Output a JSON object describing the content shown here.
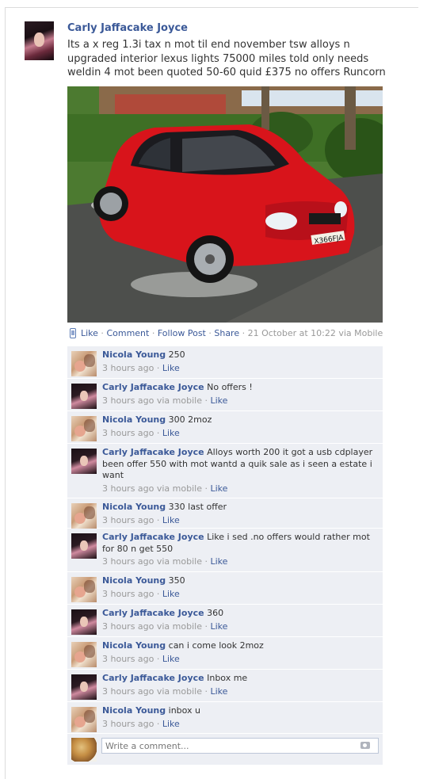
{
  "post": {
    "author": "Carly Jaffacake Joyce",
    "text": "Its a x reg 1.3i tax n mot til end november tsw alloys n upgraded interior lexus lights 75000 miles told only needs weldin 4 mot been quoted 50-60 quid £375 no offers Runcorn",
    "photo_plate": "X366FJA"
  },
  "actions": {
    "like": "Like",
    "comment": "Comment",
    "follow": "Follow Post",
    "share": "Share",
    "sep": " · ",
    "timestamp": "21 October at 10:22 via Mobile"
  },
  "comments": [
    {
      "author": "Nicola Young",
      "text": "250",
      "meta": "3 hours ago",
      "like": "Like"
    },
    {
      "author": "Carly Jaffacake Joyce",
      "text": "No offers !",
      "meta": "3 hours ago via mobile",
      "like": "Like"
    },
    {
      "author": "Nicola Young",
      "text": "300 2moz",
      "meta": "3 hours ago",
      "like": "Like"
    },
    {
      "author": "Carly Jaffacake Joyce",
      "text": "Alloys worth 200 it got a usb cdplayer been offer 550 with mot wantd a quik sale as i seen a estate i want",
      "meta": "3 hours ago via mobile",
      "like": "Like"
    },
    {
      "author": "Nicola Young",
      "text": "330 last offer",
      "meta": "3 hours ago",
      "like": "Like"
    },
    {
      "author": "Carly Jaffacake Joyce",
      "text": "Like i sed .no offers would rather mot for 80 n get 550",
      "meta": "3 hours ago via mobile",
      "like": "Like"
    },
    {
      "author": "Nicola Young",
      "text": "350",
      "meta": "3 hours ago",
      "like": "Like"
    },
    {
      "author": "Carly Jaffacake Joyce",
      "text": "360",
      "meta": "3 hours ago via mobile",
      "like": "Like"
    },
    {
      "author": "Nicola Young",
      "text": "can i come look 2moz",
      "meta": "3 hours ago",
      "like": "Like"
    },
    {
      "author": "Carly Jaffacake Joyce",
      "text": "Inbox me",
      "meta": "3 hours ago via mobile",
      "like": "Like"
    },
    {
      "author": "Nicola Young",
      "text": "inbox u",
      "meta": "3 hours ago",
      "like": "Like"
    }
  ],
  "composer": {
    "placeholder": "Write a comment..."
  },
  "colors": {
    "link": "#3b5998",
    "comment_bg": "#edeff4",
    "meta": "#999999"
  }
}
